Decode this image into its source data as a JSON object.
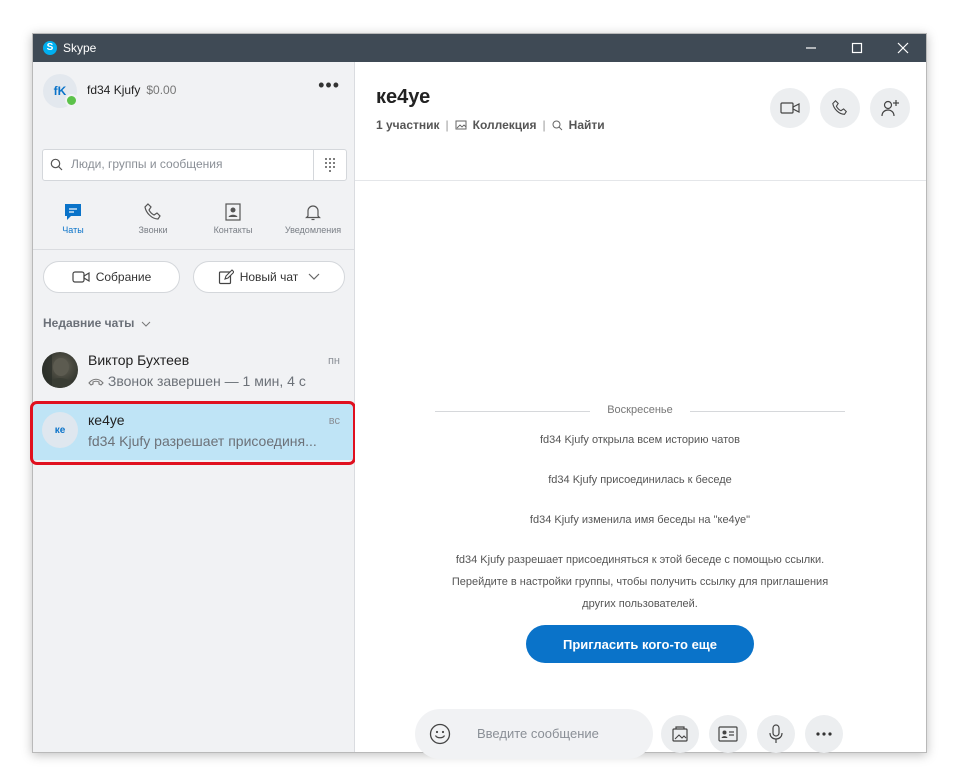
{
  "window": {
    "title": "Skype"
  },
  "profile": {
    "initials": "fK",
    "name": "fd34 Kjufy",
    "balance": "$0.00"
  },
  "search": {
    "placeholder": "Люди, группы и сообщения"
  },
  "nav": [
    {
      "label": "Чаты",
      "icon": "chat-icon",
      "active": true
    },
    {
      "label": "Звонки",
      "icon": "phone-icon"
    },
    {
      "label": "Контакты",
      "icon": "contacts-icon"
    },
    {
      "label": "Уведомления",
      "icon": "bell-icon"
    }
  ],
  "actions": {
    "meeting": "Собрание",
    "new_chat": "Новый чат"
  },
  "recent_label": "Недавние чаты",
  "chats": [
    {
      "name": "Виктор Бухтеев",
      "preview": "Звонок завершен — 1 мин, 4 с",
      "time": "пн"
    },
    {
      "name": "ке4уе",
      "initials": "ке",
      "preview": "fd34 Kjufy разрешает присоединя...",
      "time": "вс"
    }
  ],
  "conversation": {
    "title": "ке4уе",
    "participants": "1 участник",
    "collection": "Коллекция",
    "find": "Найти",
    "day": "Воскресенье",
    "messages": [
      "fd34 Kjufy открыла всем историю чатов",
      "fd34 Kjufy присоединилась к беседе",
      "fd34 Kjufy изменила имя беседы на \"ке4уе\""
    ],
    "invite_text_lines": [
      "fd34 Kjufy разрешает присоединяться к этой беседе с помощью ссылки.",
      "Перейдите в настройки группы, чтобы получить ссылку для приглашения",
      "других пользователей."
    ],
    "invite_button": "Пригласить кого-то еще",
    "compose_placeholder": "Введите сообщение"
  },
  "colors": {
    "accent": "#0a73c9",
    "titlebar": "#3f4a55",
    "sidebar": "#f1f2f4",
    "selected": "#bfe4f6",
    "highlight": "#e0101f",
    "online": "#5cc24a"
  }
}
